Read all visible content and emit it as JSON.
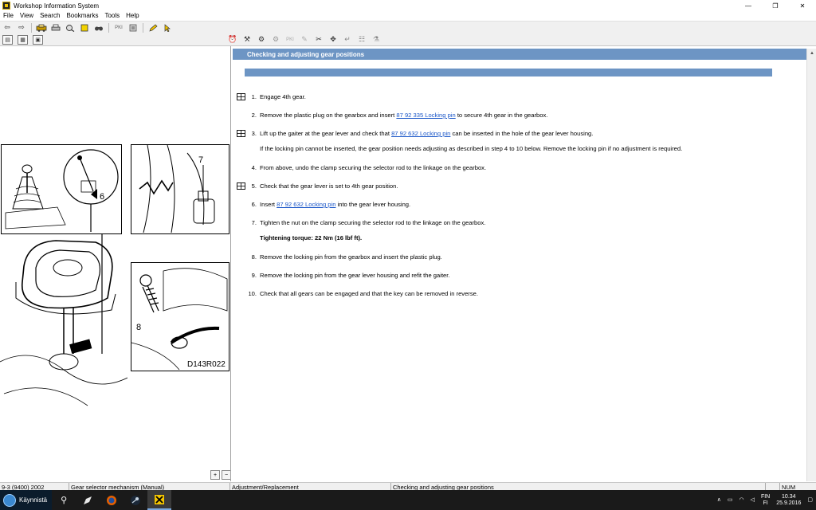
{
  "window": {
    "title": "Workshop Information System",
    "controls": {
      "minimize": "—",
      "restore": "❐",
      "close": "✕"
    }
  },
  "menu": {
    "items": [
      "File",
      "View",
      "Search",
      "Bookmarks",
      "Tools",
      "Help"
    ]
  },
  "toolbar": {
    "pkd_label": "PKI",
    "pkd2_label": "PKI"
  },
  "figure": {
    "callouts": {
      "six": "6",
      "seven": "7",
      "eight": "8"
    },
    "code": "D143R022"
  },
  "zoom": {
    "in": "+",
    "out": "−"
  },
  "document": {
    "header": "Checking and adjusting gear positions",
    "steps": [
      {
        "num": "1.",
        "text": "Engage 4th gear."
      },
      {
        "num": "2.",
        "pre": "Remove the plastic plug on the gearbox and insert ",
        "link": "87 92 335 Locking pin",
        "post": " to secure 4th gear in the gearbox."
      },
      {
        "num": "3.",
        "pre": "Lift up the gaiter at the gear lever and check that ",
        "link": "87 92 632 Locking pin",
        "post": " can be inserted in the hole of the gear lever housing."
      },
      {
        "num": "4.",
        "text": "From above, undo the clamp securing the selector rod to the linkage on the gearbox."
      },
      {
        "num": "5.",
        "text": "Check that the gear lever is set to 4th gear position."
      },
      {
        "num": "6.",
        "pre": "Insert ",
        "link": "87 92 632 Locking pin",
        "post": " into the gear lever housing."
      },
      {
        "num": "7.",
        "text": "Tighten the nut on the clamp securing the selector rod to the linkage on the gearbox."
      },
      {
        "num": "8.",
        "text": "Remove the locking pin from the gearbox and insert the plastic plug."
      },
      {
        "num": "9.",
        "text": "Remove the locking pin from the gear lever housing and refit the gaiter."
      },
      {
        "num": "10.",
        "text": "Check that all gears can be engaged and that the key can be removed in reverse."
      }
    ],
    "note_step3": "If the locking pin cannot be inserted, the gear position needs adjusting as described in step 4 to 10 below. Remove the locking pin if no adjustment is required.",
    "torque_note": "Tightening torque: 22 Nm (16 lbf ft)."
  },
  "statusbar": {
    "model": "9-3 (9400) 2002",
    "section": "Gear selector mechanism (Manual)",
    "type": "Adjustment/Replacement",
    "topic": "Checking and adjusting gear positions",
    "num": "NUM"
  },
  "taskbar": {
    "start_label": "Käynnistä",
    "search_icon": "⚲",
    "lang_top": "FIN",
    "lang_bottom": "FI",
    "time": "10.34",
    "date": "25.9.2016"
  }
}
